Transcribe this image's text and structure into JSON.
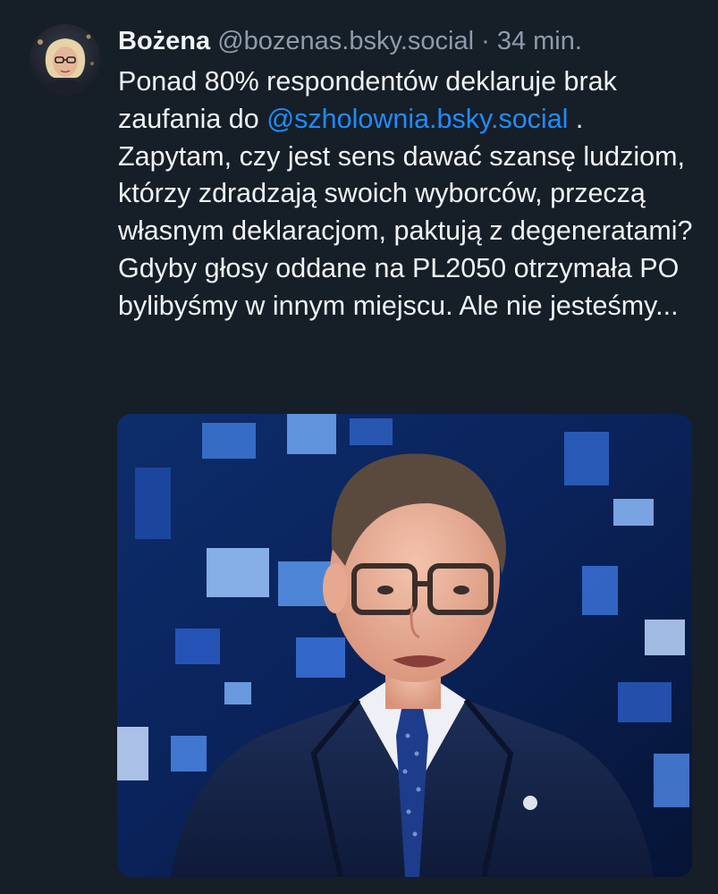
{
  "post": {
    "author_name": "Bożena",
    "author_handle": "@bozenas.bsky.social",
    "separator": "·",
    "timestamp": "34 min.",
    "text_before_mention": "Ponad 80% respondentów deklaruje brak zaufania do",
    "mention": "@szholownia.bsky.social",
    "text_after_mention": ". Zapytam, czy jest sens dawać szansę ludziom, którzy zdradzają swoich wyborców, przeczą własnym deklaracjom, paktują z degeneratami? Gdyby głosy oddane na PL2050 otrzymała PO bylibyśmy w innym miejscu. Ale nie jesteśmy...",
    "avatar_icon": "user-avatar-photo",
    "image": "tv-studio-photo-of-man-in-glasses-and-suit"
  },
  "colors": {
    "background": "#161e27",
    "text": "#f1f3f5",
    "muted": "#8c9cad",
    "link": "#208bfe"
  }
}
